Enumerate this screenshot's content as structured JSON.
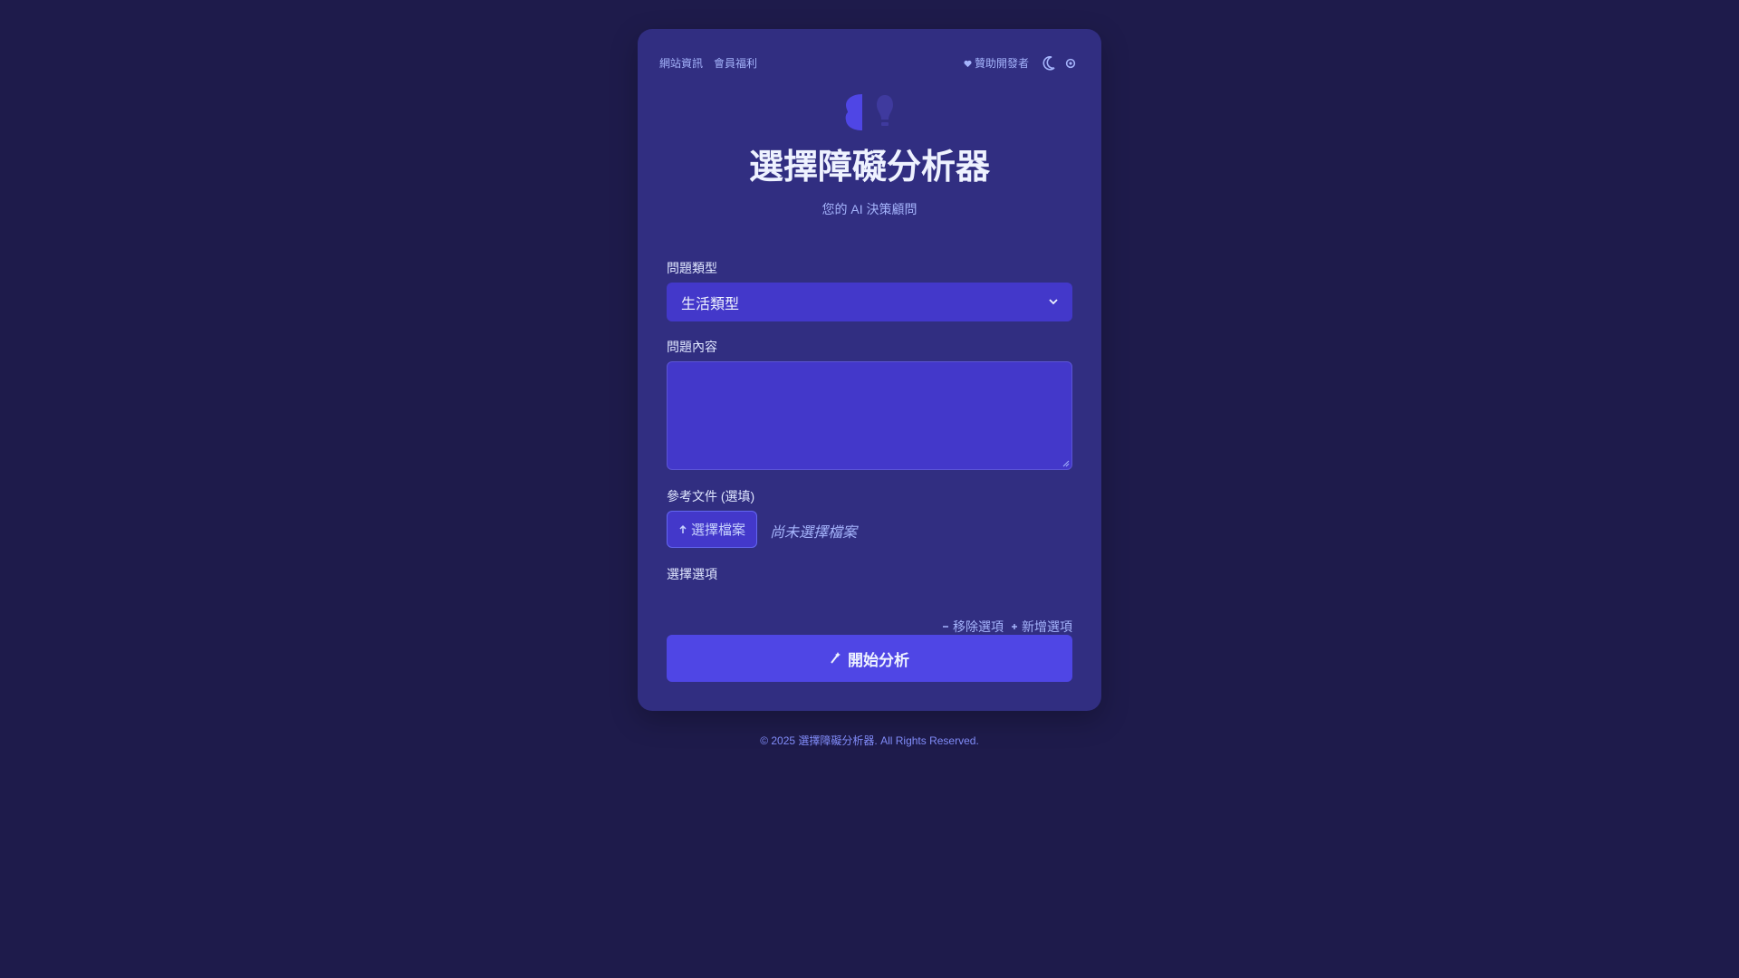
{
  "nav": {
    "site_info": "網站資訊",
    "member_benefits": "會員福利",
    "sponsor": "贊助開發者"
  },
  "header": {
    "title": "選擇障礙分析器",
    "subtitle": "您的 AI 決策顧問"
  },
  "form": {
    "question_type_label": "問題類型",
    "question_type_value": "生活類型",
    "question_content_label": "問題內容",
    "question_content_value": "",
    "reference_file_label": "參考文件 (選填)",
    "choose_file_button": "選擇檔案",
    "no_file_text": "尚未選擇檔案",
    "options_label": "選擇選項",
    "remove_option": "移除選項",
    "add_option": "新增選項",
    "submit": "開始分析"
  },
  "footer": {
    "copyright": "© 2025 選擇障礙分析器. All Rights Reserved."
  },
  "colors": {
    "background": "#1e1b4b",
    "card": "#312e81",
    "input": "#4338ca",
    "accent": "#4f46e5",
    "muted_text": "#a5b4fc"
  },
  "icons": [
    "heart-icon",
    "moon-icon",
    "settings-icon",
    "brain-icon",
    "lightbulb-icon",
    "upload-icon",
    "minus-icon",
    "plus-icon",
    "magic-icon"
  ]
}
